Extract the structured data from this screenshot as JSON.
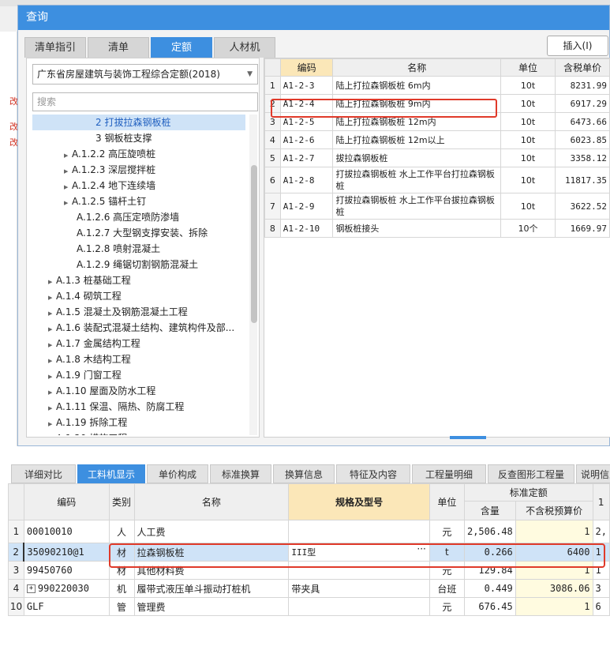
{
  "dialog": {
    "title": "查询",
    "tabs": [
      "清单指引",
      "清单",
      "定额",
      "人材机"
    ],
    "insert_label": "插入(I)"
  },
  "left": {
    "quota_book": "广东省房屋建筑与装饰工程综合定额(2018)",
    "search_placeholder": "搜索",
    "tree": [
      {
        "label": "2 打拔拉森钢板桩",
        "exp": false,
        "sel": true
      },
      {
        "label": "3 钢板桩支撑",
        "exp": false,
        "sel": false
      },
      {
        "label": "A.1.2.2 高压旋喷桩",
        "exp": true,
        "sel": false
      },
      {
        "label": "A.1.2.3 深层搅拌桩",
        "exp": true,
        "sel": false
      },
      {
        "label": "A.1.2.4 地下连续墙",
        "exp": true,
        "sel": false
      },
      {
        "label": "A.1.2.5 锚杆土钉",
        "exp": true,
        "sel": false
      },
      {
        "label": "A.1.2.6 高压定喷防渗墙",
        "exp": false,
        "sel": false
      },
      {
        "label": "A.1.2.7 大型钢支撑安装、拆除",
        "exp": false,
        "sel": false
      },
      {
        "label": "A.1.2.8 喷射混凝土",
        "exp": false,
        "sel": false
      },
      {
        "label": "A.1.2.9 绳锯切割钢筋混凝土",
        "exp": false,
        "sel": false
      },
      {
        "label": "A.1.3 桩基础工程",
        "exp": true,
        "sel": false
      },
      {
        "label": "A.1.4 砌筑工程",
        "exp": true,
        "sel": false
      },
      {
        "label": "A.1.5 混凝土及钢筋混凝土工程",
        "exp": true,
        "sel": false
      },
      {
        "label": "A.1.6 装配式混凝土结构、建筑构件及部...",
        "exp": true,
        "sel": false
      },
      {
        "label": "A.1.7 金属结构工程",
        "exp": true,
        "sel": false
      },
      {
        "label": "A.1.8 木结构工程",
        "exp": true,
        "sel": false
      },
      {
        "label": "A.1.9 门窗工程",
        "exp": true,
        "sel": false
      },
      {
        "label": "A.1.10 屋面及防水工程",
        "exp": true,
        "sel": false
      },
      {
        "label": "A.1.11 保温、隔热、防腐工程",
        "exp": true,
        "sel": false
      },
      {
        "label": "A.1.19 拆除工程",
        "exp": true,
        "sel": false
      },
      {
        "label": "A.1.20 措施工程",
        "exp": true,
        "sel": false
      }
    ]
  },
  "quota_grid": {
    "headers": [
      "编码",
      "名称",
      "单位",
      "含税单价"
    ],
    "rows": [
      {
        "n": "1",
        "code": "A1-2-3",
        "name": "陆上打拉森钢板桩 6m内",
        "unit": "10t",
        "price": "8231.99"
      },
      {
        "n": "2",
        "code": "A1-2-4",
        "name": "陆上打拉森钢板桩 9m内",
        "unit": "10t",
        "price": "6917.29"
      },
      {
        "n": "3",
        "code": "A1-2-5",
        "name": "陆上打拉森钢板桩 12m内",
        "unit": "10t",
        "price": "6473.66"
      },
      {
        "n": "4",
        "code": "A1-2-6",
        "name": "陆上打拉森钢板桩 12m以上",
        "unit": "10t",
        "price": "6023.85"
      },
      {
        "n": "5",
        "code": "A1-2-7",
        "name": "拔拉森钢板桩",
        "unit": "10t",
        "price": "3358.12"
      },
      {
        "n": "6",
        "code": "A1-2-8",
        "name": "打拔拉森钢板桩 水上工作平台打拉森钢板桩",
        "unit": "10t",
        "price": "11817.35"
      },
      {
        "n": "7",
        "code": "A1-2-9",
        "name": "打拔拉森钢板桩 水上工作平台拔拉森钢板桩",
        "unit": "10t",
        "price": "3622.52"
      },
      {
        "n": "8",
        "code": "A1-2-10",
        "name": "钢板桩接头",
        "unit": "10个",
        "price": "1669.97"
      }
    ]
  },
  "bottom_tabs": [
    "详细对比",
    "工料机显示",
    "单价构成",
    "标准换算",
    "换算信息",
    "特征及内容",
    "工程量明细",
    "反查图形工程量",
    "说明信息"
  ],
  "detail": {
    "headers": {
      "code": "编码",
      "type": "类别",
      "name": "名称",
      "spec": "规格及型号",
      "unit": "单位",
      "std": "标准定额",
      "qty": "含量",
      "price": "不含税预算价",
      "extra": "1"
    },
    "rows": [
      {
        "n": "1",
        "code": "00010010",
        "type": "人",
        "name": "人工费",
        "spec": "",
        "unit": "元",
        "qty": "2,506.48",
        "price": "1",
        "extra": "2,"
      },
      {
        "n": "2",
        "code": "35090210@1",
        "type": "材",
        "name": "拉森钢板桩",
        "spec": "III型",
        "unit": "t",
        "qty": "0.266",
        "price": "6400",
        "extra": "1"
      },
      {
        "n": "3",
        "code": "99450760",
        "type": "材",
        "name": "其他材料费",
        "spec": "",
        "unit": "元",
        "qty": "129.84",
        "price": "1",
        "extra": "1"
      },
      {
        "n": "4",
        "code": "990220030",
        "type": "机",
        "name": "履带式液压单斗振动打桩机",
        "spec": "带夹具",
        "unit": "台班",
        "qty": "0.449",
        "price": "3086.06",
        "extra": "3"
      },
      {
        "n": "10",
        "code": "GLF",
        "type": "管",
        "name": "管理费",
        "spec": "",
        "unit": "元",
        "qty": "676.45",
        "price": "1",
        "extra": "6"
      }
    ],
    "spec_menu": "···",
    "expand_mark": "+"
  },
  "background": {
    "marks": [
      "改",
      "改",
      "改"
    ]
  },
  "colors": {
    "accent": "#3d8fe0",
    "highlight_red": "#e03a2a",
    "header_highlight": "#fbe7b8",
    "selected_row": "#cfe3f7"
  }
}
